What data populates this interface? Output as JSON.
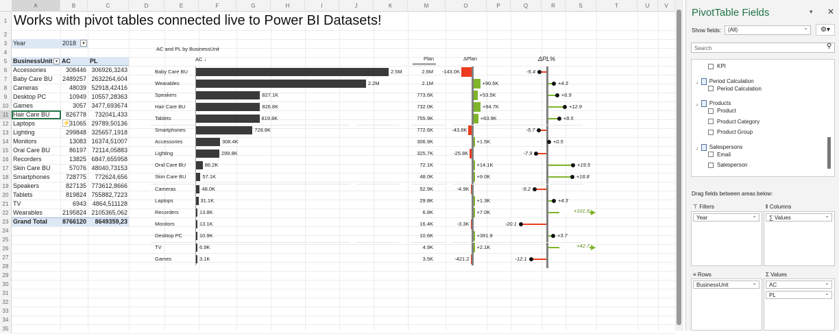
{
  "columns": [
    "A",
    "B",
    "C",
    "D",
    "E",
    "F",
    "G",
    "H",
    "I",
    "J",
    "K",
    "M",
    "O",
    "P",
    "Q",
    "R",
    "S",
    "T",
    "U",
    "V"
  ],
  "banner": "Works with pivot tables connected live to Power BI Datasets!",
  "filter": {
    "label": "Year",
    "value": "2018"
  },
  "table": {
    "headers": [
      "BusinessUnit",
      "AC",
      "PL"
    ],
    "rows": [
      [
        "Accessories",
        "308446",
        "306926,3243"
      ],
      [
        "Baby Care BU",
        "2489257",
        "2632264,604"
      ],
      [
        "Cameras",
        "48039",
        "52918,42416"
      ],
      [
        "Desktop PC",
        "10949",
        "10557,28363"
      ],
      [
        "Games",
        "3057",
        "3477,693674"
      ],
      [
        "Hair Care BU",
        "826778",
        "732041,433"
      ],
      [
        "Laptops",
        "31065",
        "29789,50136"
      ],
      [
        "Lighting",
        "299848",
        "325657,1918"
      ],
      [
        "Monitors",
        "13083",
        "16374,51007"
      ],
      [
        "Oral Care BU",
        "86197",
        "72114,05883"
      ],
      [
        "Recorders",
        "13825",
        "6847,655958"
      ],
      [
        "Skin Care BU",
        "57076",
        "48040,73153"
      ],
      [
        "Smartphones",
        "728775",
        "772624,656"
      ],
      [
        "Speakers",
        "827135",
        "773612,8666"
      ],
      [
        "Tablets",
        "819824",
        "755882,7223"
      ],
      [
        "TV",
        "6943",
        "4864,511128"
      ],
      [
        "Wearables",
        "2195824",
        "2105365,062"
      ]
    ],
    "total": [
      "Grand Total",
      "8766120",
      "8649359,23"
    ]
  },
  "chart_data": {
    "type": "bar",
    "title": "AC and PL by BusinessUnit",
    "ac_header": "AC ↓",
    "plan_header": "Plan",
    "dplan_header": "ΔPlan",
    "dpl_header": "ΔPL%",
    "categories": [
      "Baby Care BU",
      "Wearables",
      "Speakers",
      "Hair Care BU",
      "Tablets",
      "Smartphones",
      "Accessories",
      "Lighting",
      "Oral Care BU",
      "Skin Care BU",
      "Cameras",
      "Laptops",
      "Recorders",
      "Monitors",
      "Desktop PC",
      "TV",
      "Games"
    ],
    "ac": [
      2489257,
      2195824,
      827135,
      826778,
      819824,
      728775,
      308446,
      299848,
      86197,
      57076,
      48039,
      31065,
      13825,
      13083,
      10949,
      6943,
      3057
    ],
    "ac_labels": [
      "2.5M",
      "2.2M",
      "827.1K",
      "826.8K",
      "819.8K",
      "728.8K",
      "308.4K",
      "299.8K",
      "86.2K",
      "57.1K",
      "48.0K",
      "31.1K",
      "13.8K",
      "13.1K",
      "10.9K",
      "6.9K",
      "3.1K"
    ],
    "plan_labels": [
      "2.6M",
      "2.1M",
      "773.6K",
      "732.0K",
      "755.9K",
      "772.6K",
      "306.9K",
      "325.7K",
      "72.1K",
      "48.0K",
      "52.9K",
      "29.8K",
      "6.8K",
      "16.4K",
      "10.6K",
      "4.9K",
      "3.5K"
    ],
    "dplan": [
      -143.0,
      90.5,
      53.5,
      94.7,
      63.9,
      -43.8,
      1.5,
      -25.8,
      14.1,
      9.0,
      -4.9,
      1.3,
      7.0,
      -3.3,
      0.392,
      2.1,
      -0.421
    ],
    "dplan_labels": [
      "-143.0K",
      "+90.5K",
      "+53.5K",
      "+94.7K",
      "+63.9K",
      "-43.8K",
      "+1.5K",
      "-25.8K",
      "+14.1K",
      "+9.0K",
      "-4.9K",
      "+1.3K",
      "+7.0K",
      "-3.3K",
      "+391.9",
      "+2.1K",
      "-421.2"
    ],
    "dpl": [
      -5.4,
      4.3,
      6.9,
      12.9,
      8.5,
      -5.7,
      0.5,
      -7.9,
      19.5,
      18.8,
      -9.2,
      4.3,
      101.9,
      -20.1,
      3.7,
      42.7,
      -12.1
    ],
    "dpl_labels": [
      "-5.4",
      "+4.3",
      "+6.9",
      "+12.9",
      "+8.5",
      "-5.7",
      "+0.5",
      "-7.9",
      "+19.5",
      "+18.8",
      "-9.2",
      "+4.3",
      "+101.9",
      "-20.1",
      "+3.7",
      "+42.7",
      "-12.1"
    ],
    "colors": {
      "bar": "#3a3a3a",
      "pos": "#7fb52a",
      "neg": "#ee3b1f",
      "axis": "#808080"
    }
  },
  "panel": {
    "title": "PivotTable Fields",
    "show_fields_label": "Show fields:",
    "show_fields_value": "(All)",
    "search_placeholder": "Search",
    "fields": [
      {
        "t": "KPI",
        "lvl": 1
      },
      {
        "t": "Period Calculation",
        "lvl": 0
      },
      {
        "t": "Period Calculation",
        "lvl": 1
      },
      {
        "t": "Products",
        "lvl": 0
      },
      {
        "t": "Product",
        "lvl": 1
      },
      {
        "t": "Product Category",
        "lvl": 1
      },
      {
        "t": "Product Group",
        "lvl": 1
      },
      {
        "t": "Salespersons",
        "lvl": 0
      },
      {
        "t": "Email",
        "lvl": 1
      },
      {
        "t": "Salesperson",
        "lvl": 1
      }
    ],
    "drag_hint": "Drag fields between areas below:",
    "filters": "Filters",
    "columns": "Columns",
    "rows": "Rows",
    "values": "Values",
    "filters_items": [
      "Year"
    ],
    "columns_items": [
      "∑ Values"
    ],
    "rows_items": [
      "BusinessUnit"
    ],
    "values_items": [
      "AC",
      "PL"
    ]
  }
}
